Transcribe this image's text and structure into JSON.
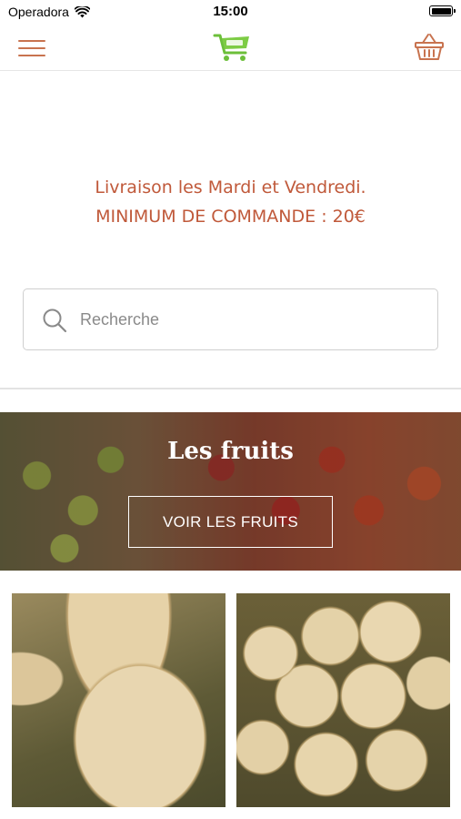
{
  "status_bar": {
    "carrier": "Operadora",
    "time": "15:00",
    "wifi_icon": "wifi-icon",
    "battery_icon": "battery-icon"
  },
  "nav_bar": {
    "menu_icon": "hamburger-menu-icon",
    "logo_icon": "shopping-cart-logo",
    "cart_icon": "basket-icon",
    "accent_color": "#c8734f",
    "logo_color": "#6cbf3a"
  },
  "delivery_info": {
    "line1": "Livraison les Mardi et Vendredi.",
    "line2": "MINIMUM DE COMMANDE : 20€",
    "color": "#c0593a"
  },
  "search": {
    "placeholder": "Recherche",
    "value": "",
    "icon": "search-icon"
  },
  "category_banner": {
    "title": "Les fruits",
    "button_label": "VOIR LES FRUITS"
  },
  "products": [
    {
      "image": "melon-closeup-photo"
    },
    {
      "image": "melons-pile-photo"
    }
  ]
}
